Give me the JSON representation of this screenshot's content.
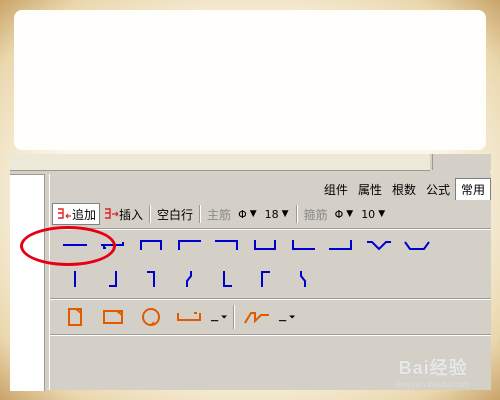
{
  "tabs": [
    "组件",
    "属性",
    "根数",
    "公式",
    "常用"
  ],
  "toolbar": {
    "append_label": "追加",
    "insert_label": "插入",
    "blank_row_label": "空白行",
    "main_bar_label": "主筋",
    "main_bar_grade": "Φ",
    "main_bar_diameter": "18",
    "stirrup_label": "箍筋",
    "stirrup_grade": "Φ",
    "stirrup_diameter": "10"
  },
  "shape_rows": [
    {
      "name": "horizontal-bar-shapes",
      "color": "#0000cc",
      "icons": [
        "straight-bar-icon",
        "hook-bar-icon",
        "u-down-bar-icon",
        "l-left-down-bar-icon",
        "l-right-down-bar-icon",
        "u-up-bar-icon",
        "l-up-bar-icon",
        "l-right-up-bar-icon",
        "v-bend-bar-icon",
        "trough-bar-icon"
      ]
    },
    {
      "name": "vertical-bar-shapes",
      "color": "#0000cc",
      "icons": [
        "vertical-bar-icon",
        "j-bar-icon",
        "bent-top-bar-icon",
        "zigzag-bar-icon",
        "l-vertical-bar-icon",
        "gamma-bar-icon",
        "bent-vertical-bar-icon"
      ]
    },
    {
      "name": "stirrup-shapes",
      "color": "#e05a00",
      "icons": [
        "rect-stirrup-icon",
        "square-stirrup-icon",
        "circle-stirrup-icon",
        "open-stirrup-icon",
        "stirrup-dropdown-icon",
        "step-bar-icon",
        "step-dropdown-icon"
      ]
    }
  ],
  "watermark": {
    "brand": "Bai经验",
    "url": "jingyan.baidu.com"
  },
  "colors": {
    "highlight": "#e60012",
    "shape_blue": "#0000cc",
    "stirrup_orange": "#e05a00",
    "panel": "#d4d0c8"
  }
}
